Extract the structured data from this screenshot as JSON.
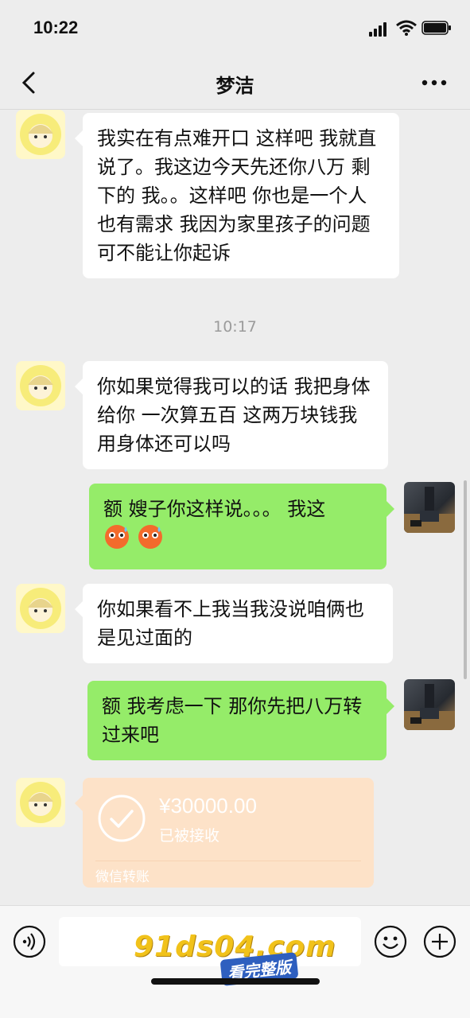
{
  "status_bar": {
    "time": "10:22"
  },
  "header": {
    "title": "梦洁"
  },
  "messages": {
    "m1": "我实在有点难开口 这样吧 我就直说了。我这边今天先还你八万 剩下的 我。。这样吧 你也是一个人 也有需求 我因为家里孩子的问题 可不能让你起诉",
    "timestamp": "10:17",
    "m2": "  你如果觉得我可以的话 我把身体给你 一次算五百 这两万块钱我用身体还可以吗",
    "m3": "额 嫂子你这样说。。。 我这",
    "m4": "你如果看不上我当我没说咱俩也是见过面的",
    "m5": "额 我考虑一下 那你先把八万转过来吧"
  },
  "transfer": {
    "amount": "¥30000.00",
    "status": "已被接收",
    "footer": "微信转账"
  },
  "watermark": {
    "site": "91ds04.com",
    "tag": "看完整版"
  },
  "icons": {
    "back": "chevron-left-icon",
    "more": "more-icon",
    "voice": "voice-icon",
    "emoji": "emoji-icon",
    "plus": "plus-icon"
  },
  "colors": {
    "outgoing_bubble": "#95ec69",
    "incoming_bubble": "#ffffff",
    "transfer_bg": "#fde2c8"
  }
}
